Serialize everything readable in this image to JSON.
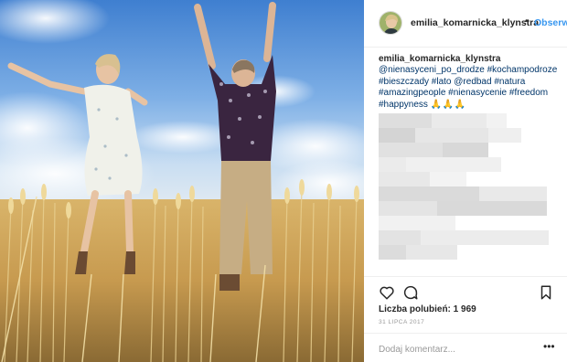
{
  "post": {
    "photo_alt": "",
    "header": {
      "username": "emilia_komarnicka_klynstra",
      "separator": "•",
      "follow_label": "Obserwuj"
    },
    "caption": {
      "username": "emilia_komarnicka_klynstra",
      "mention": "@nienasyceni_po_drodze",
      "hashtags_line1": "#kochampodroze",
      "hashtags_line2": "#bieszczady #lato @redbad #natura",
      "hashtags_line3": "#amazingpeople #nienasycenie #freedom",
      "hashtags_line4": "#happyness",
      "emoji": "🙏🙏🙏"
    },
    "likes": {
      "label": "Liczba polubień:",
      "count": "1 969"
    },
    "date": "31 LIPCA 2017",
    "comment": {
      "placeholder": "Dodaj komentarz...",
      "more": "•••"
    },
    "icons": {
      "like": "heart-icon",
      "comment": "comment-icon",
      "save": "bookmark-icon",
      "more": "more-options-icon"
    },
    "colors": {
      "follow_blue": "#3897f0",
      "hashtag_blue": "#003569",
      "text": "#262626",
      "muted": "#999999",
      "divider": "#efefef"
    }
  }
}
